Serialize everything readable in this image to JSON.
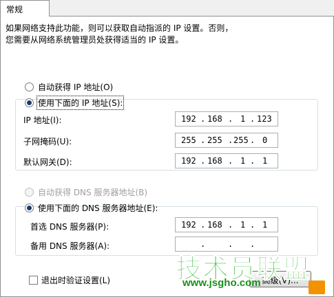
{
  "tab": {
    "label": "常规"
  },
  "intro": {
    "line1": "如果网络支持此功能，则可以获取自动指派的 IP 设置。否则，",
    "line2": "您需要从网络系统管理员处获得适当的 IP 设置。"
  },
  "ip_section": {
    "auto_label": "自动获得 IP 地址(O)",
    "manual_label": "使用下面的 IP 地址(S):",
    "selected": "manual",
    "fields": [
      {
        "label": "IP 地址(I):",
        "octets": [
          "192",
          "168",
          "1",
          "123"
        ]
      },
      {
        "label": "子网掩码(U):",
        "octets": [
          "255",
          "255",
          "255",
          "0"
        ]
      },
      {
        "label": "默认网关(D):",
        "octets": [
          "192",
          "168",
          "1",
          "1"
        ]
      }
    ]
  },
  "dns_section": {
    "auto_label": "自动获得 DNS 服务器地址(B)",
    "manual_label": "使用下面的 DNS 服务器地址(E):",
    "selected": "manual",
    "fields": [
      {
        "label": "首选 DNS 服务器(P):",
        "octets": [
          "192",
          "168",
          "1",
          "1"
        ]
      },
      {
        "label": "备用 DNS 服务器(A):",
        "octets": [
          "",
          "",
          "",
          ""
        ]
      }
    ]
  },
  "validate_on_exit": {
    "label": "退出时验证设置(L)",
    "checked": false
  },
  "advanced_button": {
    "label": "高级(V)..."
  },
  "watermark": {
    "text": "技术员联盟",
    "url": "www.jsgho.com"
  },
  "colors": {
    "radio_dot": "#1a3a70",
    "group_border": "#d5dfe5",
    "watermark_green": "#2db52d"
  }
}
